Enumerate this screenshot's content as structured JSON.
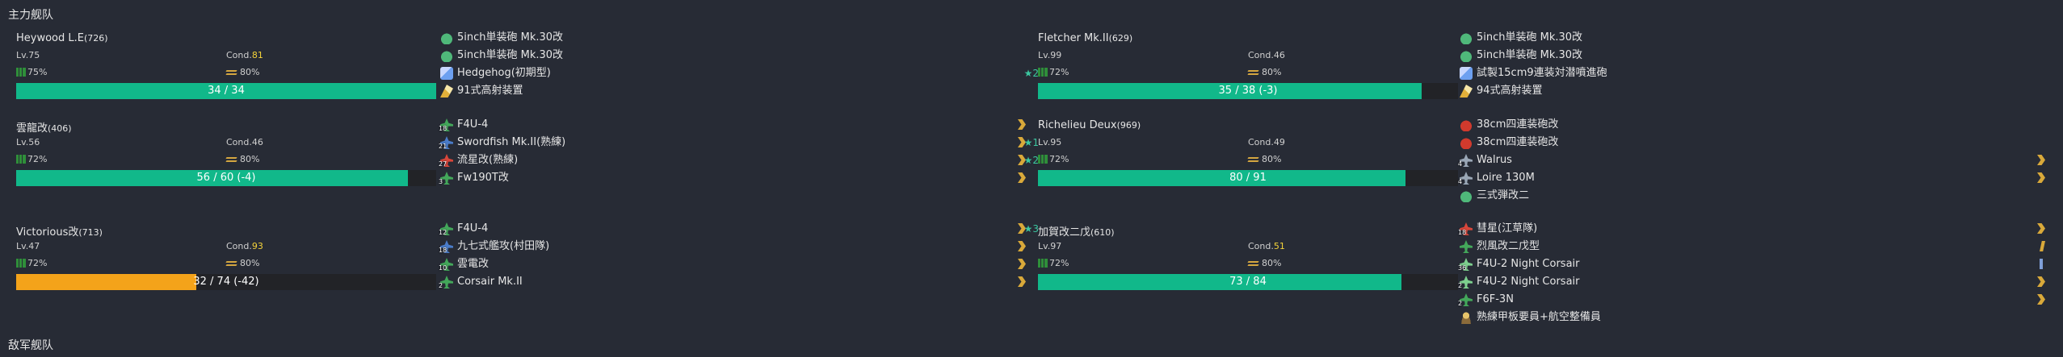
{
  "sections": {
    "main_fleet": "主力舰队",
    "enemy_fleet": "敌军舰队"
  },
  "colors": {
    "background": "#272b35",
    "hp_green": "#11b88a",
    "hp_orange": "#f4a31a",
    "cond_high": "#f3d23a",
    "proficiency": "#d9a93a",
    "star": "#3cc7a0"
  },
  "ships": [
    {
      "name": "Heywood L.E",
      "id": "(726)",
      "lv": "Lv.75",
      "cond_label": "Cond.",
      "cond_value": "81",
      "cond_high": true,
      "fuel": "75%",
      "ammo": "80%",
      "hp_text": "34 / 34",
      "hp_fraction": 1.0,
      "hp_color": "green",
      "equipment": [
        {
          "name": "5inch単装砲 Mk.30改",
          "icon": "gun-icon",
          "slot": "",
          "prof": "",
          "star": ""
        },
        {
          "name": "5inch単装砲 Mk.30改",
          "icon": "gun-icon",
          "slot": "",
          "prof": "",
          "star": ""
        },
        {
          "name": "Hedgehog(初期型)",
          "icon": "asw-icon",
          "slot": "",
          "prof": "",
          "star": "★2"
        },
        {
          "name": "91式高射装置",
          "icon": "aa-icon",
          "slot": "",
          "prof": "",
          "star": ""
        }
      ]
    },
    {
      "name": "Fletcher Mk.II",
      "id": "(629)",
      "lv": "Lv.99",
      "cond_label": "Cond.",
      "cond_value": "46",
      "cond_high": false,
      "fuel": "72%",
      "ammo": "80%",
      "hp_text": "35 / 38 (-3)",
      "hp_fraction": 0.921,
      "hp_color": "green",
      "equipment": [
        {
          "name": "5inch単装砲 Mk.30改",
          "icon": "gun-icon",
          "slot": "",
          "prof": "",
          "star": ""
        },
        {
          "name": "5inch単装砲 Mk.30改",
          "icon": "gun-icon",
          "slot": "",
          "prof": "",
          "star": ""
        },
        {
          "name": "試製15cm9連装対潜噴進砲",
          "icon": "asw-icon",
          "slot": "",
          "prof": "",
          "star": ""
        },
        {
          "name": "94式高射装置",
          "icon": "aa-icon",
          "slot": "",
          "prof": "",
          "star": ""
        }
      ]
    },
    {
      "name": "雲龍改",
      "id": "(406)",
      "lv": "Lv.56",
      "cond_label": "Cond.",
      "cond_value": "46",
      "cond_high": false,
      "fuel": "72%",
      "ammo": "80%",
      "hp_text": "56 / 60 (-4)",
      "hp_fraction": 0.933,
      "hp_color": "green",
      "equipment": [
        {
          "name": "F4U-4",
          "icon": "plane-green",
          "slot": "18",
          "prof": "chev",
          "star": ""
        },
        {
          "name": "Swordfish Mk.II(熟練)",
          "icon": "plane-blue",
          "slot": "21",
          "prof": "chev",
          "star": "★1"
        },
        {
          "name": "流星改(熟練)",
          "icon": "plane-red",
          "slot": "27",
          "prof": "chev",
          "star": "★2"
        },
        {
          "name": "Fw190T改",
          "icon": "plane-green",
          "slot": "3",
          "prof": "chev",
          "star": ""
        }
      ]
    },
    {
      "name": "Richelieu Deux",
      "id": "(969)",
      "lv": "Lv.95",
      "cond_label": "Cond.",
      "cond_value": "49",
      "cond_high": false,
      "fuel": "72%",
      "ammo": "80%",
      "hp_text": "80 / 91",
      "hp_fraction": 0.879,
      "hp_color": "green",
      "equipment": [
        {
          "name": "38cm四連装砲改",
          "icon": "gun-red",
          "slot": "",
          "prof": "",
          "star": ""
        },
        {
          "name": "38cm四連装砲改",
          "icon": "gun-red",
          "slot": "",
          "prof": "",
          "star": ""
        },
        {
          "name": "Walrus",
          "icon": "plane-gray",
          "slot": "4",
          "prof": "chev",
          "star": ""
        },
        {
          "name": "Loire 130M",
          "icon": "plane-gray",
          "slot": "4",
          "prof": "chev",
          "star": ""
        },
        {
          "name": "三式弾改二",
          "icon": "gun-icon",
          "slot": "",
          "prof": "",
          "star": ""
        }
      ]
    },
    {
      "name": "Victorious改",
      "id": "(713)",
      "lv": "Lv.47",
      "cond_label": "Cond.",
      "cond_value": "93",
      "cond_high": true,
      "fuel": "72%",
      "ammo": "80%",
      "hp_text": "32 / 74 (-42)",
      "hp_fraction": 0.432,
      "hp_color": "orange",
      "equipment": [
        {
          "name": "F4U-4",
          "icon": "plane-green",
          "slot": "12",
          "prof": "chev",
          "star": "★3"
        },
        {
          "name": "九七式艦攻(村田隊)",
          "icon": "plane-blue",
          "slot": "18",
          "prof": "chev",
          "star": ""
        },
        {
          "name": "雲電改",
          "icon": "plane-green",
          "slot": "10",
          "prof": "chev",
          "star": ""
        },
        {
          "name": "Corsair Mk.II",
          "icon": "plane-green",
          "slot": "2",
          "prof": "chev",
          "star": ""
        }
      ]
    },
    {
      "name": "加賀改二戊",
      "id": "(610)",
      "lv": "Lv.97",
      "cond_label": "Cond.",
      "cond_value": "51",
      "cond_high": true,
      "fuel": "72%",
      "ammo": "80%",
      "hp_text": "73 / 84",
      "hp_fraction": 0.869,
      "hp_color": "green",
      "equipment": [
        {
          "name": "彗星(江草隊)",
          "icon": "plane-red",
          "slot": "18",
          "prof": "chev",
          "star": ""
        },
        {
          "name": "烈風改二戊型",
          "icon": "plane-green",
          "slot": "",
          "prof": "slash",
          "star": ""
        },
        {
          "name": "F4U-2 Night Corsair",
          "icon": "plane-lgreen",
          "slot": "36",
          "prof": "bar-blue",
          "star": ""
        },
        {
          "name": "F4U-2 Night Corsair",
          "icon": "plane-lgreen",
          "slot": "2",
          "prof": "chev",
          "star": ""
        },
        {
          "name": "F6F-3N",
          "icon": "plane-green",
          "slot": "2",
          "prof": "chev",
          "star": ""
        },
        {
          "name": "熟練甲板要員+航空整備員",
          "icon": "crew-icon",
          "slot": "",
          "prof": "",
          "star": ""
        }
      ]
    }
  ]
}
